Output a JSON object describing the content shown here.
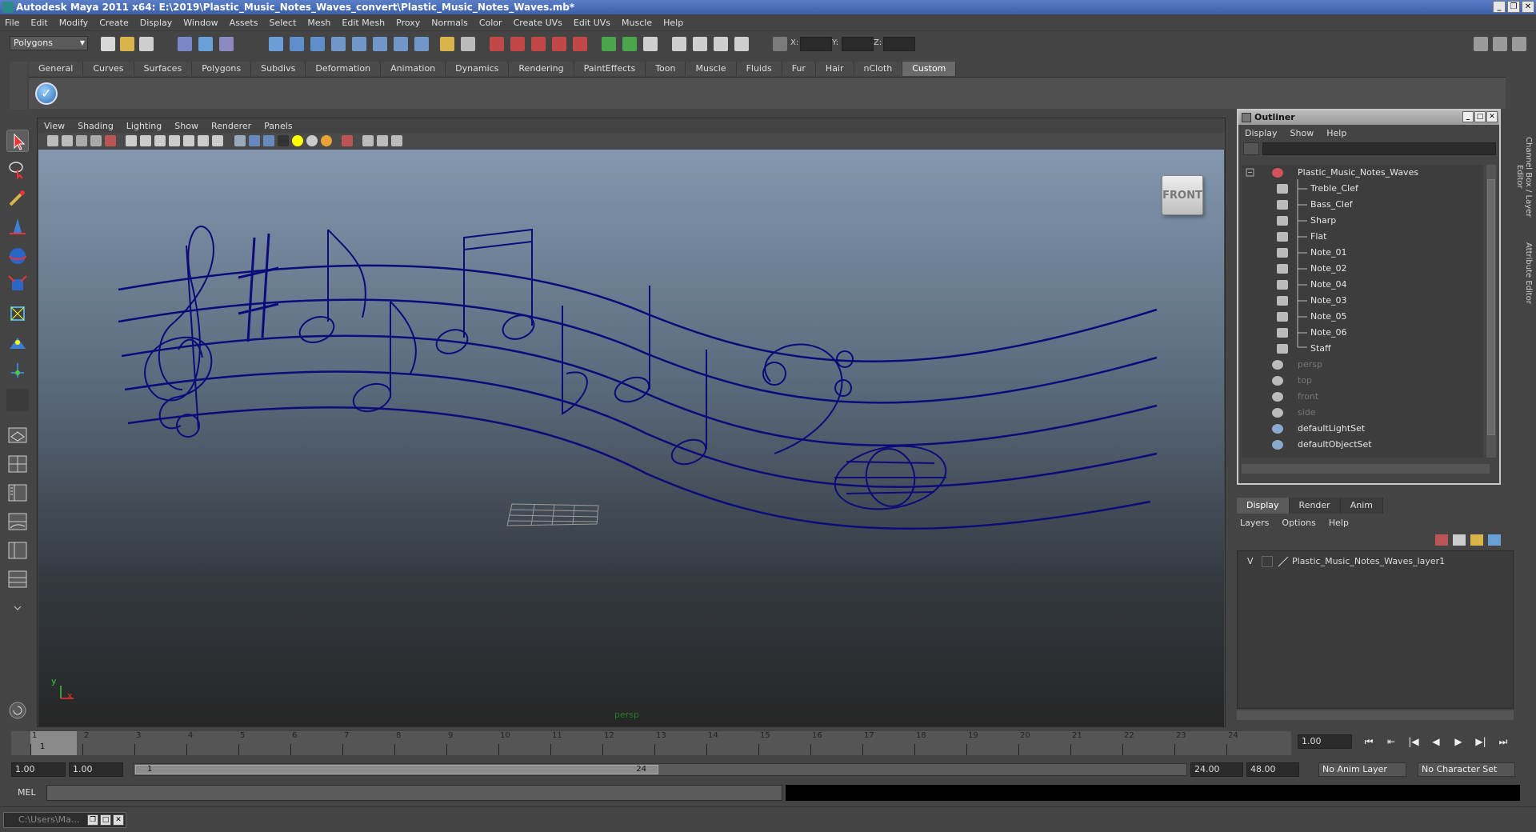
{
  "window": {
    "title": "Autodesk Maya 2011 x64: E:\\2019\\Plastic_Music_Notes_Waves_convert\\Plastic_Music_Notes_Waves.mb*"
  },
  "menu": [
    "File",
    "Edit",
    "Modify",
    "Create",
    "Display",
    "Window",
    "Assets",
    "Select",
    "Mesh",
    "Edit Mesh",
    "Proxy",
    "Normals",
    "Color",
    "Create UVs",
    "Edit UVs",
    "Muscle",
    "Help"
  ],
  "status_line": {
    "mode": "Polygons",
    "x_label": "X:",
    "y_label": "Y:",
    "z_label": "Z:"
  },
  "shelf": {
    "tabs": [
      "General",
      "Curves",
      "Surfaces",
      "Polygons",
      "Subdivs",
      "Deformation",
      "Animation",
      "Dynamics",
      "Rendering",
      "PaintEffects",
      "Toon",
      "Muscle",
      "Fluids",
      "Fur",
      "Hair",
      "nCloth",
      "Custom"
    ],
    "active_tab": "Custom"
  },
  "viewport": {
    "menu": [
      "View",
      "Shading",
      "Lighting",
      "Show",
      "Renderer",
      "Panels"
    ],
    "viewcube_label": "FRONT",
    "camera_label": "persp",
    "axis_y": "y",
    "axis_x": "x"
  },
  "outliner": {
    "title": "Outliner",
    "menu": [
      "Display",
      "Show",
      "Help"
    ],
    "items": [
      {
        "label": "Plastic_Music_Notes_Waves",
        "level": 0,
        "kind": "root"
      },
      {
        "label": "Treble_Clef",
        "level": 1,
        "kind": "mesh"
      },
      {
        "label": "Bass_Clef",
        "level": 1,
        "kind": "mesh"
      },
      {
        "label": "Sharp",
        "level": 1,
        "kind": "mesh"
      },
      {
        "label": "Flat",
        "level": 1,
        "kind": "mesh"
      },
      {
        "label": "Note_01",
        "level": 1,
        "kind": "mesh"
      },
      {
        "label": "Note_02",
        "level": 1,
        "kind": "mesh"
      },
      {
        "label": "Note_04",
        "level": 1,
        "kind": "mesh"
      },
      {
        "label": "Note_03",
        "level": 1,
        "kind": "mesh"
      },
      {
        "label": "Note_05",
        "level": 1,
        "kind": "mesh"
      },
      {
        "label": "Note_06",
        "level": 1,
        "kind": "mesh"
      },
      {
        "label": "Staff",
        "level": 1,
        "kind": "mesh"
      },
      {
        "label": "persp",
        "level": 0,
        "kind": "camera"
      },
      {
        "label": "top",
        "level": 0,
        "kind": "camera"
      },
      {
        "label": "front",
        "level": 0,
        "kind": "camera"
      },
      {
        "label": "side",
        "level": 0,
        "kind": "camera"
      },
      {
        "label": "defaultLightSet",
        "level": 0,
        "kind": "set"
      },
      {
        "label": "defaultObjectSet",
        "level": 0,
        "kind": "set"
      }
    ]
  },
  "layer_editor": {
    "tabs": [
      "Display",
      "Render",
      "Anim"
    ],
    "active_tab": "Display",
    "menu": [
      "Layers",
      "Options",
      "Help"
    ],
    "layer": {
      "visibility": "V",
      "name": "Plastic_Music_Notes_Waves_layer1"
    }
  },
  "side_tabs": [
    "Channel Box / Layer Editor",
    "Attribute Editor"
  ],
  "time_slider": {
    "ticks": [
      "1",
      "2",
      "3",
      "4",
      "5",
      "6",
      "7",
      "8",
      "9",
      "10",
      "11",
      "12",
      "13",
      "14",
      "15",
      "16",
      "17",
      "18",
      "19",
      "20",
      "21",
      "22",
      "23",
      "24"
    ],
    "current_frame": "1",
    "current_time_field": "1.00"
  },
  "range_slider": {
    "start_time": "1.00",
    "playback_start": "1.00",
    "range_start_label": "1",
    "range_end_label": "24",
    "playback_end": "24.00",
    "end_time": "48.00",
    "anim_layer": "No Anim Layer",
    "character_set": "No Character Set"
  },
  "command_line": {
    "label": "MEL"
  },
  "taskbar": {
    "item": "C:\\Users\\Ma..."
  },
  "colors": {
    "wireframe": "#0b0b7a",
    "viewport_top": "#8397ae",
    "viewport_bottom": "#262626"
  }
}
